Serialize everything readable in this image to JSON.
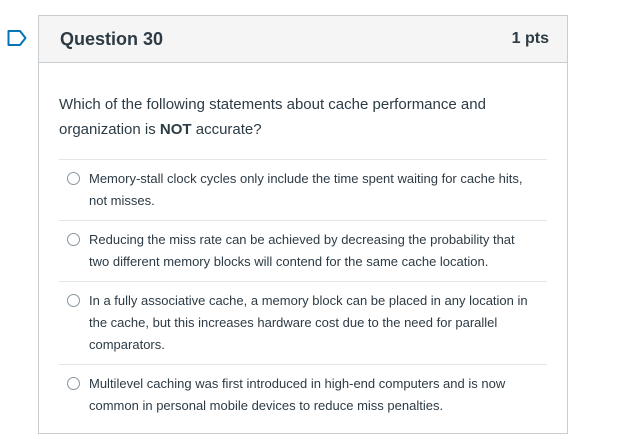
{
  "question": {
    "title": "Question 30",
    "points": "1 pts",
    "text_before": "Which of the following statements about cache performance and organization is ",
    "text_emphasis": "NOT",
    "text_after": " accurate?",
    "answers": [
      {
        "label": "Memory-stall clock cycles only include the time spent waiting for cache hits, not misses."
      },
      {
        "label": "Reducing the miss rate can be achieved by decreasing the probability that two different memory blocks will contend for the same cache location."
      },
      {
        "label": "In a fully associative cache, a memory block can be placed in any location in the cache, but this increases hardware cost due to the need for parallel comparators."
      },
      {
        "label": "Multilevel caching was first introduced in high-end computers and is now common in personal mobile devices to reduce miss penalties."
      }
    ]
  },
  "icons": {
    "flag": "flag-question-icon"
  },
  "colors": {
    "flag": "#0374b5",
    "header_bg": "#f5f5f5",
    "border": "#c7cdd1",
    "text": "#2d3b45"
  }
}
